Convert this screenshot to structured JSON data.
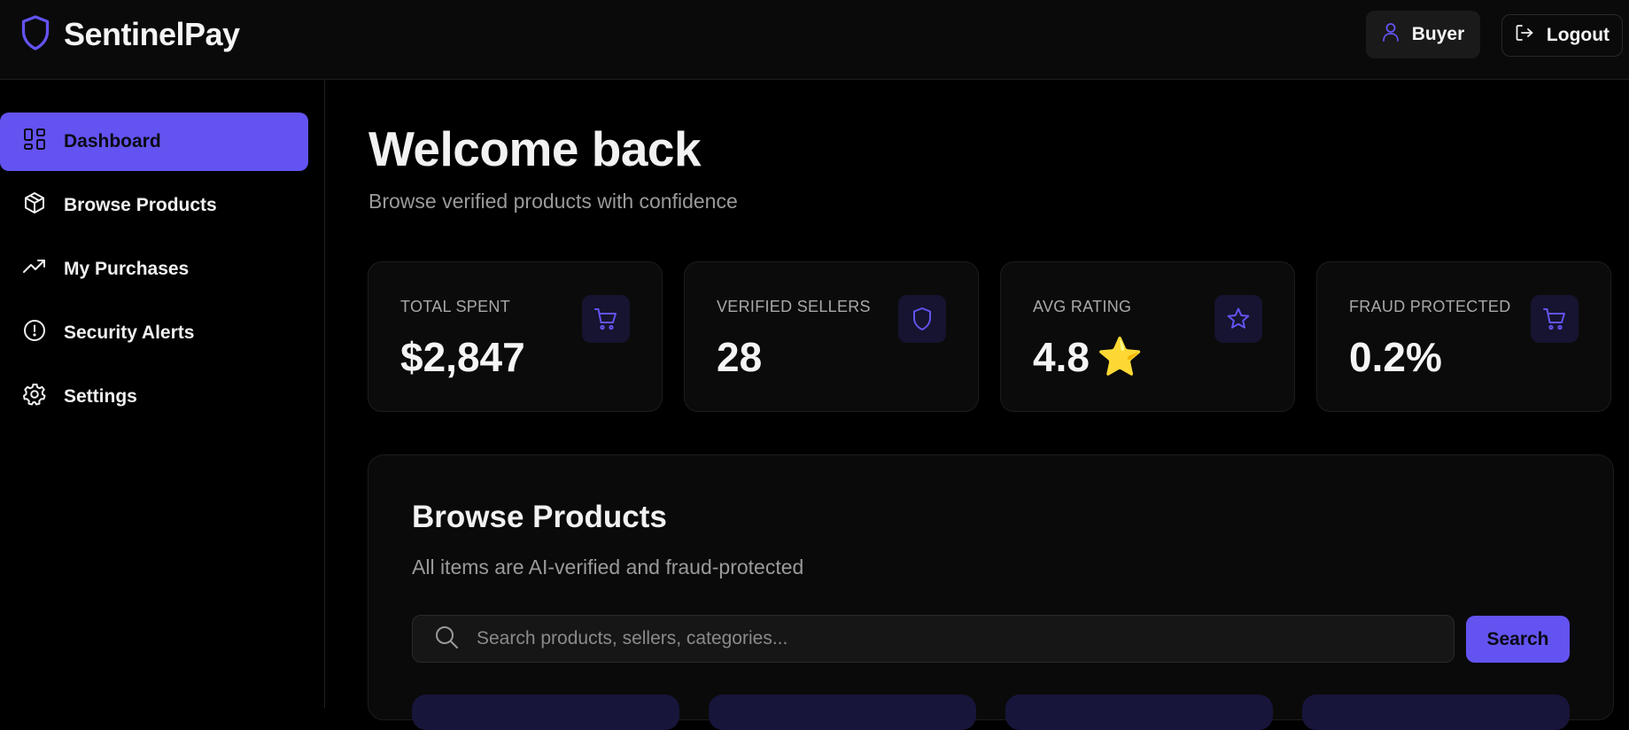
{
  "app": {
    "name": "SentinelPay",
    "accent": "#6353f0"
  },
  "header": {
    "role_label": "Buyer",
    "logout_label": "Logout"
  },
  "sidebar": {
    "items": [
      {
        "label": "Dashboard",
        "icon": "dashboard-icon",
        "active": true
      },
      {
        "label": "Browse Products",
        "icon": "package-icon",
        "active": false
      },
      {
        "label": "My Purchases",
        "icon": "trending-up-icon",
        "active": false
      },
      {
        "label": "Security Alerts",
        "icon": "alert-circle-icon",
        "active": false
      },
      {
        "label": "Settings",
        "icon": "gear-icon",
        "active": false
      }
    ]
  },
  "main": {
    "title": "Welcome back",
    "subtitle": "Browse verified products with confidence",
    "stats": [
      {
        "label": "TOTAL SPENT",
        "value": "$2,847",
        "icon": "cart-icon"
      },
      {
        "label": "VERIFIED SELLERS",
        "value": "28",
        "icon": "shield-icon"
      },
      {
        "label": "AVG RATING",
        "value": "4.8",
        "emoji": "⭐",
        "icon": "star-icon"
      },
      {
        "label": "FRAUD PROTECTED",
        "value": "0.2%",
        "icon": "cart-icon"
      }
    ]
  },
  "browse": {
    "title": "Browse Products",
    "subtitle": "All items are AI-verified and fraud-protected",
    "search_placeholder": "Search products, sellers, categories...",
    "search_button": "Search"
  }
}
